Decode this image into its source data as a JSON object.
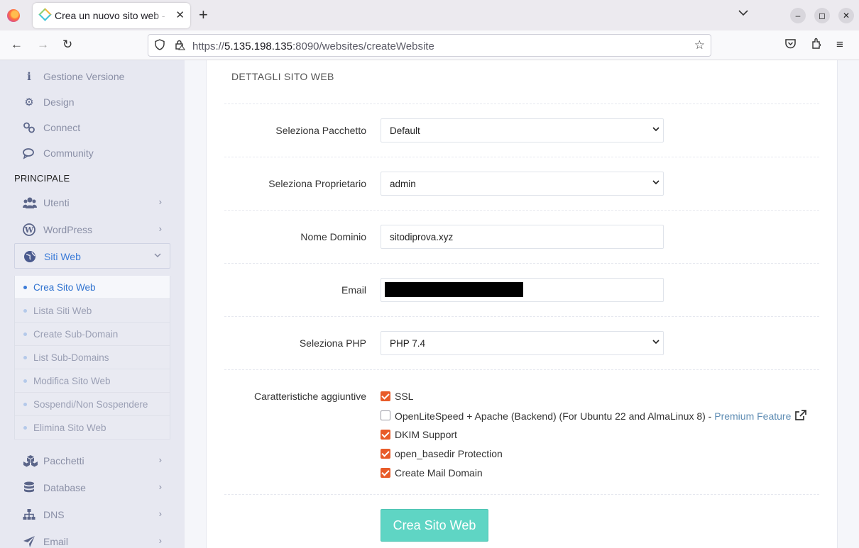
{
  "browser": {
    "tab_title": "Crea un nuovo sito web - CyberPanel",
    "url_prefix": "https://",
    "url_host": "5.135.198.135",
    "url_rest": ":8090/websites/createWebsite"
  },
  "sidebar": {
    "top_items": [
      {
        "label": "Gestione Versione",
        "icon": "info-icon"
      },
      {
        "label": "Design",
        "icon": "gear-icon"
      },
      {
        "label": "Connect",
        "icon": "link-icon"
      },
      {
        "label": "Community",
        "icon": "chat-icon"
      }
    ],
    "section_label": "PRINCIPALE",
    "main_items": [
      {
        "label": "Utenti",
        "icon": "users-icon"
      },
      {
        "label": "WordPress",
        "icon": "wordpress-icon"
      },
      {
        "label": "Siti Web",
        "icon": "globe-icon"
      }
    ],
    "submenu": [
      "Crea Sito Web",
      "Lista Siti Web",
      "Create Sub-Domain",
      "List Sub-Domains",
      "Modifica Sito Web",
      "Sospendi/Non Sospendere",
      "Elimina Sito Web"
    ],
    "bottom_items": [
      {
        "label": "Pacchetti",
        "icon": "cubes-icon"
      },
      {
        "label": "Database",
        "icon": "database-icon"
      },
      {
        "label": "DNS",
        "icon": "sitemap-icon"
      },
      {
        "label": "Email",
        "icon": "paper-plane-icon"
      }
    ]
  },
  "form": {
    "title": "DETTAGLI SITO WEB",
    "package_label": "Seleziona Pacchetto",
    "package_value": "Default",
    "owner_label": "Seleziona Proprietario",
    "owner_value": "admin",
    "domain_label": "Nome Dominio",
    "domain_value": "sitodiprova.xyz",
    "email_label": "Email",
    "php_label": "Seleziona PHP",
    "php_value": "PHP 7.4",
    "features_label": "Caratteristiche aggiuntive",
    "features": [
      {
        "label": "SSL",
        "checked": true
      },
      {
        "label": "OpenLiteSpeed + Apache (Backend) (For Ubuntu 22 and AlmaLinux 8) - ",
        "premium": "Premium Feature",
        "checked": false
      },
      {
        "label": "DKIM Support",
        "checked": true
      },
      {
        "label": "open_basedir Protection",
        "checked": true
      },
      {
        "label": "Create Mail Domain",
        "checked": true
      }
    ],
    "submit_label": "Crea Sito Web"
  },
  "colors": {
    "accent": "#3b7bd8",
    "checkbox": "#e85b29",
    "submit": "#5fd5c4"
  }
}
